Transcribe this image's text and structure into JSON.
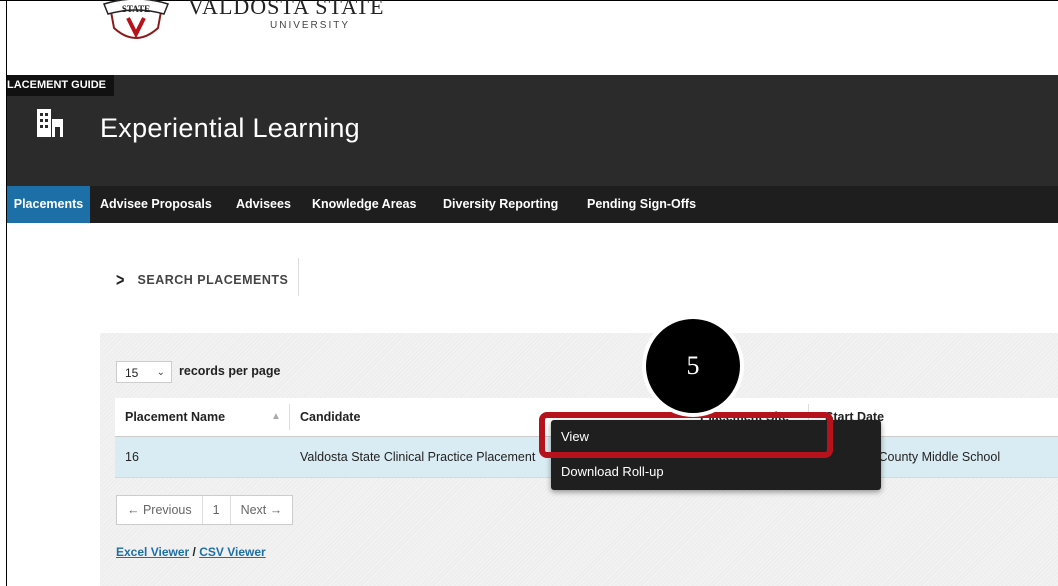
{
  "logo": {
    "title": "VALDOSTA STATE",
    "subtitle": "UNIVERSITY",
    "seal_text": "STATE"
  },
  "header": {
    "guide_tag": "LACEMENT GUIDE",
    "title": "Experiential Learning"
  },
  "nav": {
    "tabs": [
      {
        "label": "Placements",
        "active": true
      },
      {
        "label": "Advisee Proposals"
      },
      {
        "label": "Advisees"
      },
      {
        "label": "Knowledge Areas"
      },
      {
        "label": "Diversity Reporting"
      },
      {
        "label": "Pending Sign-Offs"
      }
    ]
  },
  "search": {
    "label": "SEARCH PLACEMENTS"
  },
  "table": {
    "records_per_page": "15",
    "records_label": "records per page",
    "columns": [
      "Placement Name",
      "Candidate",
      "Placement Site",
      "Start Date"
    ],
    "rows": [
      {
        "placement_name": "16",
        "candidate": "Valdosta State Clinical Practice Placement",
        "site": "Lowndes County Middle School"
      }
    ]
  },
  "pager": {
    "previous": "← Previous",
    "page": "1",
    "next": "Next →"
  },
  "export": {
    "excel": "Excel Viewer",
    "slash": " / ",
    "csv": "CSV Viewer"
  },
  "context_menu": {
    "items": [
      "View",
      "Download Roll-up"
    ]
  },
  "callout": {
    "number": "5"
  },
  "colors": {
    "accent": "#1d6fa8",
    "header_bg": "#2b2b2b",
    "highlight": "#b5121b",
    "row_bg": "#d9ecf3"
  }
}
